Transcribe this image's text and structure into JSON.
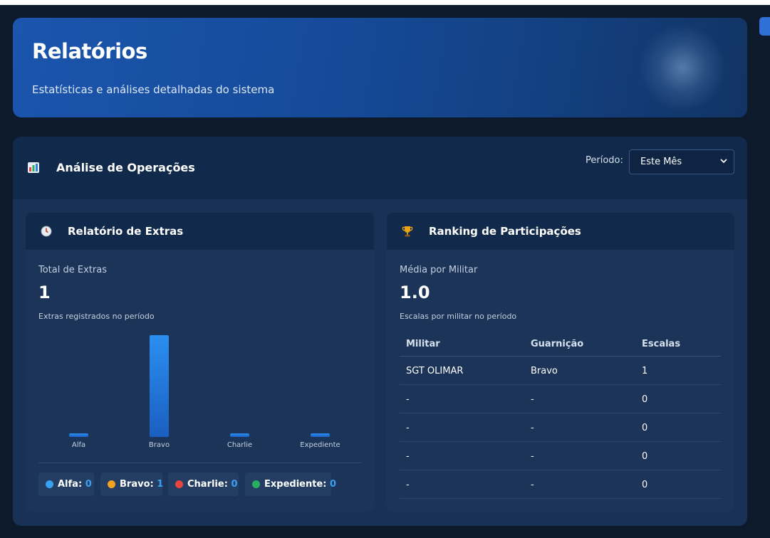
{
  "hero": {
    "title": "Relatórios",
    "subtitle": "Estatísticas e análises detalhadas do sistema"
  },
  "operations": {
    "icon": "bar-chart-icon",
    "title": "Análise de Operações",
    "period_label": "Período:",
    "period_value": "Este Mês"
  },
  "extras": {
    "icon": "clock-icon",
    "title": "Relatório de Extras",
    "total_label": "Total de Extras",
    "total_value": "1",
    "total_sub": "Extras registrados no período",
    "legend": [
      {
        "name": "Alfa:",
        "value": "0",
        "color": "#3aa0f0"
      },
      {
        "name": "Bravo:",
        "value": "1",
        "color": "#f2a323"
      },
      {
        "name": "Charlie:",
        "value": "0",
        "color": "#e8453c"
      },
      {
        "name": "Expediente:",
        "value": "0",
        "color": "#27ae60"
      }
    ]
  },
  "ranking": {
    "icon": "trophy-icon",
    "title": "Ranking de Participações",
    "avg_label": "Média por Militar",
    "avg_value": "1.0",
    "avg_sub": "Escalas por militar no período",
    "columns": [
      "Militar",
      "Guarnição",
      "Escalas"
    ],
    "rows": [
      [
        "SGT OLIMAR",
        "Bravo",
        "1"
      ],
      [
        "-",
        "-",
        "0"
      ],
      [
        "-",
        "-",
        "0"
      ],
      [
        "-",
        "-",
        "0"
      ],
      [
        "-",
        "-",
        "0"
      ]
    ]
  },
  "chart_data": {
    "type": "bar",
    "categories": [
      "Alfa",
      "Bravo",
      "Charlie",
      "Expediente"
    ],
    "values": [
      0,
      1,
      0,
      0
    ],
    "title": "",
    "xlabel": "",
    "ylabel": "",
    "ylim": [
      0,
      1
    ],
    "grid": false,
    "bar_color": "#2b8ff0"
  }
}
